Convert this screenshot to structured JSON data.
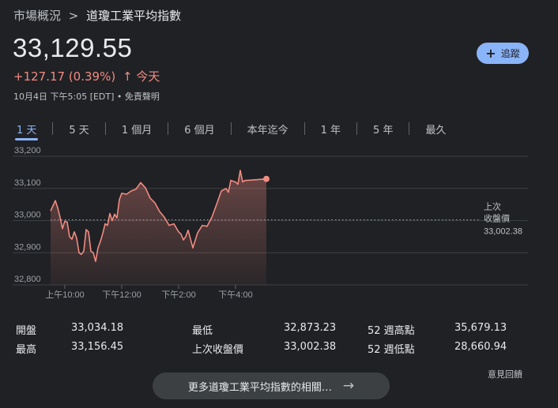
{
  "breadcrumb": {
    "parent": "市場概況",
    "separator": ">",
    "current": "道瓊工業平均指數"
  },
  "quote": {
    "price": "33,129.55",
    "change": "+127.17 (0.39%)",
    "change_arrow": "↑",
    "change_period": "今天",
    "timestamp": "10月4日 下午5:05 [EDT] • 免責聲明"
  },
  "follow_button": {
    "label": "追蹤",
    "icon": "plus-icon"
  },
  "tabs": [
    {
      "label": "1 天",
      "active": true
    },
    {
      "label": "5 天"
    },
    {
      "label": "1 個月"
    },
    {
      "label": "6 個月"
    },
    {
      "label": "本年迄今"
    },
    {
      "label": "1 年"
    },
    {
      "label": "5 年"
    },
    {
      "label": "最久"
    }
  ],
  "chart_data": {
    "type": "line",
    "x": [
      "09:30",
      "09:40",
      "09:45",
      "09:50",
      "09:55",
      "10:00",
      "10:05",
      "10:10",
      "10:15",
      "10:20",
      "10:25",
      "10:30",
      "10:35",
      "10:40",
      "10:45",
      "10:50",
      "10:55",
      "11:00",
      "11:05",
      "11:10",
      "11:15",
      "11:20",
      "11:25",
      "11:30",
      "11:35",
      "11:40",
      "11:45",
      "11:50",
      "11:55",
      "12:00",
      "12:10",
      "12:20",
      "12:30",
      "12:40",
      "12:50",
      "13:00",
      "13:10",
      "13:20",
      "13:30",
      "13:40",
      "13:50",
      "14:00",
      "14:05",
      "14:10",
      "14:15",
      "14:20",
      "14:30",
      "14:40",
      "14:50",
      "15:00",
      "15:10",
      "15:20",
      "15:30",
      "15:40",
      "15:45",
      "15:50",
      "16:00",
      "16:05",
      "16:10",
      "16:15",
      "16:20",
      "16:25",
      "17:05"
    ],
    "y": [
      33030,
      33062,
      33040,
      33010,
      32975,
      32998,
      32995,
      32950,
      32942,
      32965,
      32945,
      32900,
      32895,
      32905,
      32972,
      32965,
      32905,
      32900,
      32873,
      32915,
      32935,
      32960,
      32990,
      32985,
      33022,
      33000,
      33020,
      33008,
      33065,
      33085,
      33082,
      33092,
      33098,
      33118,
      33102,
      33070,
      33055,
      33028,
      33010,
      32985,
      32990,
      32965,
      32958,
      32940,
      32950,
      32970,
      32915,
      32962,
      32985,
      32982,
      33010,
      33050,
      33092,
      33100,
      33088,
      33125,
      33120,
      33113,
      33156,
      33120,
      33125,
      33125,
      33129.55
    ],
    "yticks": [
      "33,200",
      "33,100",
      "33,000",
      "32,900",
      "32,800"
    ],
    "xticks": [
      "上午10:00",
      "下午12:00",
      "下午2:00",
      "下午4:00"
    ],
    "ylim": [
      32800,
      33200
    ],
    "previous_close": 33002.38,
    "previous_close_label": [
      "上次",
      "收盤價"
    ],
    "previous_close_value": "33,002.38",
    "line_color": "#f28b82",
    "grid": true
  },
  "stats": [
    {
      "label1": "開盤",
      "value1": "33,034.18",
      "label2": "最低",
      "value2": "32,873.23",
      "label3": "52 週高點",
      "value3": "35,679.13"
    },
    {
      "label1": "最高",
      "value1": "33,156.45",
      "label2": "上次收盤價",
      "value2": "33,002.38",
      "label3": "52 週低點",
      "value3": "28,660.94"
    }
  ],
  "feedback": "意見回饋",
  "more_button": {
    "label": "更多道瓊工業平均指數的相關…",
    "icon": "arrow-right-icon"
  }
}
